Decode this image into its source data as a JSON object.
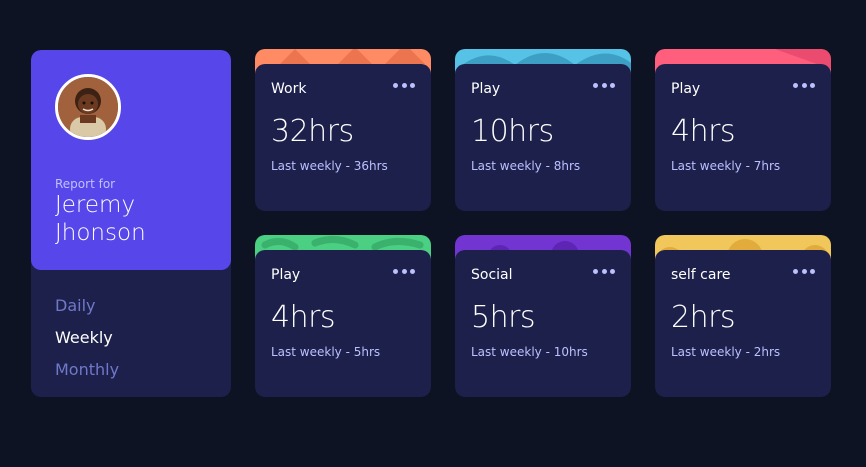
{
  "profile": {
    "report_for": "Report for",
    "name": "Jeremy Jhonson",
    "avatar_icon": "avatar-photo"
  },
  "periods": [
    {
      "label": "Daily",
      "active": false
    },
    {
      "label": "Weekly",
      "active": true
    },
    {
      "label": "Monthly",
      "active": false
    }
  ],
  "cards": [
    {
      "title": "Work",
      "hours": "32hrs",
      "previous": "Last weekly - 36hrs",
      "color": "#ff8b64",
      "menu_icon": "ellipsis-icon"
    },
    {
      "title": "Play",
      "hours": "10hrs",
      "previous": "Last weekly - 8hrs",
      "color": "#55c2e6",
      "menu_icon": "ellipsis-icon"
    },
    {
      "title": "Play",
      "hours": "4hrs",
      "previous": "Last weekly - 7hrs",
      "color": "#ff5e7d",
      "menu_icon": "ellipsis-icon"
    },
    {
      "title": "Play",
      "hours": "4hrs",
      "previous": "Last weekly - 5hrs",
      "color": "#4bcf82",
      "menu_icon": "ellipsis-icon"
    },
    {
      "title": "Social",
      "hours": "5hrs",
      "previous": "Last weekly - 10hrs",
      "color": "#7335d2",
      "menu_icon": "ellipsis-icon"
    },
    {
      "title": "self care",
      "hours": "2hrs",
      "previous": "Last weekly - 2hrs",
      "color": "#f1c75b",
      "menu_icon": "ellipsis-icon"
    }
  ],
  "theme": {
    "background": "#0e1323",
    "card_body": "#1c204b",
    "profile_accent": "#5747ea",
    "muted_text": "#bbc0ff"
  }
}
